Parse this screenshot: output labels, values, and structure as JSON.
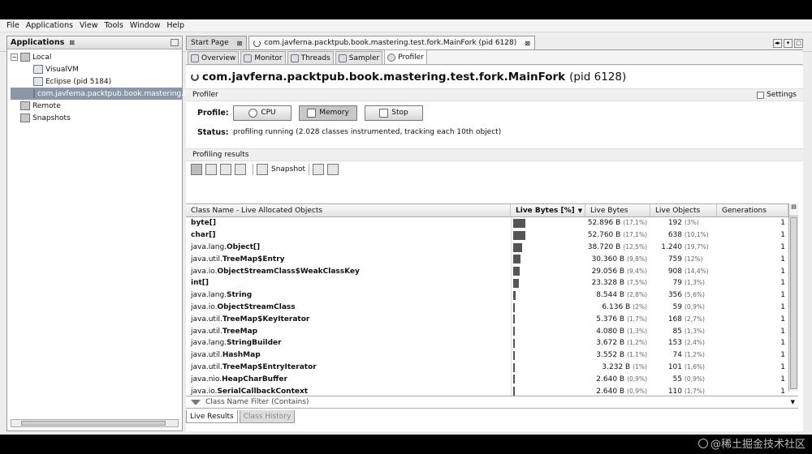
{
  "menu": [
    "File",
    "Applications",
    "View",
    "Tools",
    "Window",
    "Help"
  ],
  "applications_panel": {
    "title": "Applications",
    "tree": [
      {
        "label": "Local",
        "level": 0,
        "toggle": "−"
      },
      {
        "label": "VisualVM",
        "level": 1
      },
      {
        "label": "Eclipse (pid 5184)",
        "level": 1
      },
      {
        "label": "com.javferna.packtpub.book.mastering.te",
        "level": 1,
        "selected": true
      },
      {
        "label": "Remote",
        "level": 0
      },
      {
        "label": "Snapshots",
        "level": 0
      }
    ]
  },
  "doc_tabs": [
    {
      "label": "Start Page"
    },
    {
      "label": "com.javferna.packtpub.book.mastering.test.fork.MainFork (pid 6128)",
      "active": true
    }
  ],
  "sub_tabs": [
    {
      "label": "Overview"
    },
    {
      "label": "Monitor"
    },
    {
      "label": "Threads"
    },
    {
      "label": "Sampler"
    },
    {
      "label": "Profiler",
      "active": true
    }
  ],
  "process": {
    "name": "com.javferna.packtpub.book.mastering.test.fork.MainFork",
    "pid": "(pid 6128)"
  },
  "profiler": {
    "section_title": "Profiler",
    "settings_label": "Settings",
    "profile_label": "Profile:",
    "buttons": {
      "cpu": "CPU",
      "memory": "Memory",
      "stop": "Stop"
    },
    "status_label": "Status:",
    "status_text": "profiling running (2.028 classes instrumented, tracking each 10th object)"
  },
  "results": {
    "section_title": "Profiling results",
    "snapshot_label": "Snapshot",
    "columns": [
      "Class Name - Live Allocated Objects",
      "Live Bytes [%]",
      "Live Bytes",
      "Live Objects",
      "Generations"
    ],
    "rows": [
      {
        "prefix": "",
        "name": "byte[]",
        "pct_value": 17.1,
        "bytes": "52.896 B",
        "bytes_pct": "(17,1%)",
        "objects": "192",
        "obj_pct": "(3%)",
        "gen": "1"
      },
      {
        "prefix": "",
        "name": "char[]",
        "pct_value": 17.1,
        "bytes": "52.760 B",
        "bytes_pct": "(17,1%)",
        "objects": "638",
        "obj_pct": "(10,1%)",
        "gen": "1"
      },
      {
        "prefix": "java.lang.",
        "name": "Object[]",
        "pct_value": 12.5,
        "bytes": "38.720 B",
        "bytes_pct": "(12,5%)",
        "objects": "1.240",
        "obj_pct": "(19,7%)",
        "gen": "1"
      },
      {
        "prefix": "java.util.",
        "name": "TreeMap$Entry",
        "pct_value": 9.8,
        "bytes": "30.360 B",
        "bytes_pct": "(9,8%)",
        "objects": "759",
        "obj_pct": "(12%)",
        "gen": "1"
      },
      {
        "prefix": "java.io.",
        "name": "ObjectStreamClass$WeakClassKey",
        "pct_value": 9.4,
        "bytes": "29.056 B",
        "bytes_pct": "(9,4%)",
        "objects": "908",
        "obj_pct": "(14,4%)",
        "gen": "1"
      },
      {
        "prefix": "",
        "name": "int[]",
        "pct_value": 7.5,
        "bytes": "23.328 B",
        "bytes_pct": "(7,5%)",
        "objects": "79",
        "obj_pct": "(1,3%)",
        "gen": "1"
      },
      {
        "prefix": "java.lang.",
        "name": "String",
        "pct_value": 2.8,
        "bytes": "8.544 B",
        "bytes_pct": "(2,8%)",
        "objects": "356",
        "obj_pct": "(5,6%)",
        "gen": "1"
      },
      {
        "prefix": "java.io.",
        "name": "ObjectStreamClass",
        "pct_value": 2,
        "bytes": "6.136 B",
        "bytes_pct": "(2%)",
        "objects": "59",
        "obj_pct": "(0,9%)",
        "gen": "1"
      },
      {
        "prefix": "java.util.",
        "name": "TreeMap$KeyIterator",
        "pct_value": 1.7,
        "bytes": "5.376 B",
        "bytes_pct": "(1,7%)",
        "objects": "168",
        "obj_pct": "(2,7%)",
        "gen": "1"
      },
      {
        "prefix": "java.util.",
        "name": "TreeMap",
        "pct_value": 1.3,
        "bytes": "4.080 B",
        "bytes_pct": "(1,3%)",
        "objects": "85",
        "obj_pct": "(1,3%)",
        "gen": "1"
      },
      {
        "prefix": "java.lang.",
        "name": "StringBuilder",
        "pct_value": 1.2,
        "bytes": "3.672 B",
        "bytes_pct": "(1,2%)",
        "objects": "153",
        "obj_pct": "(2,4%)",
        "gen": "1"
      },
      {
        "prefix": "java.util.",
        "name": "HashMap",
        "pct_value": 1.1,
        "bytes": "3.552 B",
        "bytes_pct": "(1,1%)",
        "objects": "74",
        "obj_pct": "(1,2%)",
        "gen": "1"
      },
      {
        "prefix": "java.util.",
        "name": "TreeMap$EntryIterator",
        "pct_value": 1,
        "bytes": "3.232 B",
        "bytes_pct": "(1%)",
        "objects": "101",
        "obj_pct": "(1,6%)",
        "gen": "1"
      },
      {
        "prefix": "java.nio.",
        "name": "HeapCharBuffer",
        "pct_value": 0.9,
        "bytes": "2.640 B",
        "bytes_pct": "(0,9%)",
        "objects": "55",
        "obj_pct": "(0,9%)",
        "gen": "1"
      },
      {
        "prefix": "java.io.",
        "name": "SerialCallbackContext",
        "pct_value": 0.9,
        "bytes": "2.640 B",
        "bytes_pct": "(0,9%)",
        "objects": "110",
        "obj_pct": "(1,7%)",
        "gen": "1"
      }
    ],
    "filter_placeholder": "Class Name Filter (Contains)",
    "bottom_tabs": [
      "Live Results",
      "Class History"
    ]
  },
  "watermark": "@稀土掘金技术社区"
}
